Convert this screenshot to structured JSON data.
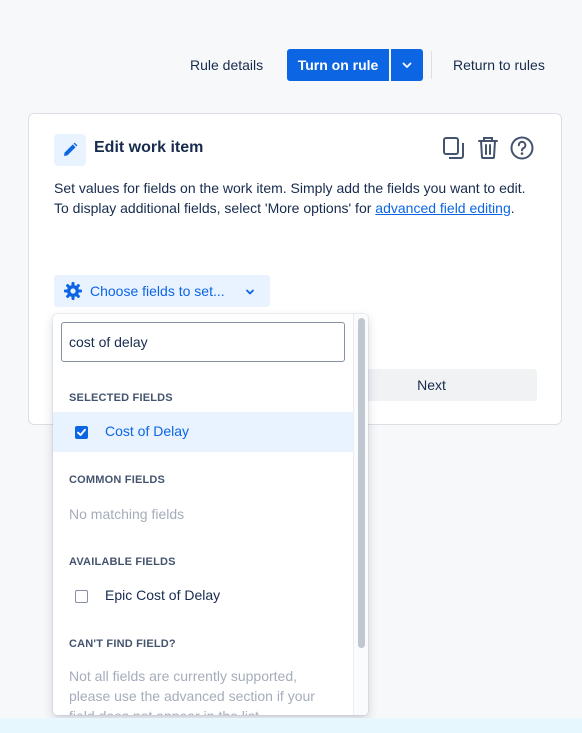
{
  "header": {
    "rule_details": "Rule details",
    "turn_on_rule": "Turn on rule",
    "return_to_rules": "Return to rules"
  },
  "card": {
    "title": "Edit work item",
    "desc_line1": "Set values for fields on the work item. Simply add the fields you want to edit.",
    "desc_line2_prefix": "To display additional fields, select 'More options' for ",
    "desc_link": "advanced field editing",
    "desc_line2_suffix": ".",
    "choose_fields": "Choose fields to set...",
    "next": "Next"
  },
  "dropdown": {
    "search_value": "cost of delay",
    "selected_heading": "SELECTED FIELDS",
    "selected_items": [
      {
        "label": "Cost of Delay",
        "checked": true
      }
    ],
    "common_heading": "COMMON FIELDS",
    "common_empty": "No matching fields",
    "available_heading": "AVAILABLE FIELDS",
    "available_items": [
      {
        "label": "Epic Cost of Delay",
        "checked": false
      }
    ],
    "cant_find_heading": "CAN'T FIND FIELD?",
    "cant_find_text": "Not all fields are currently supported, please use the advanced section if your field does not appear in the list."
  },
  "colors": {
    "primary": "#0c66e4",
    "selected_bg": "#e9f2ff",
    "muted_text": "#a5adba"
  },
  "icons": [
    "edit-icon",
    "copy-icon",
    "trash-icon",
    "help-icon",
    "gear-icon",
    "chevron-down-icon",
    "checkbox-checked-icon",
    "checkbox-empty-icon"
  ]
}
